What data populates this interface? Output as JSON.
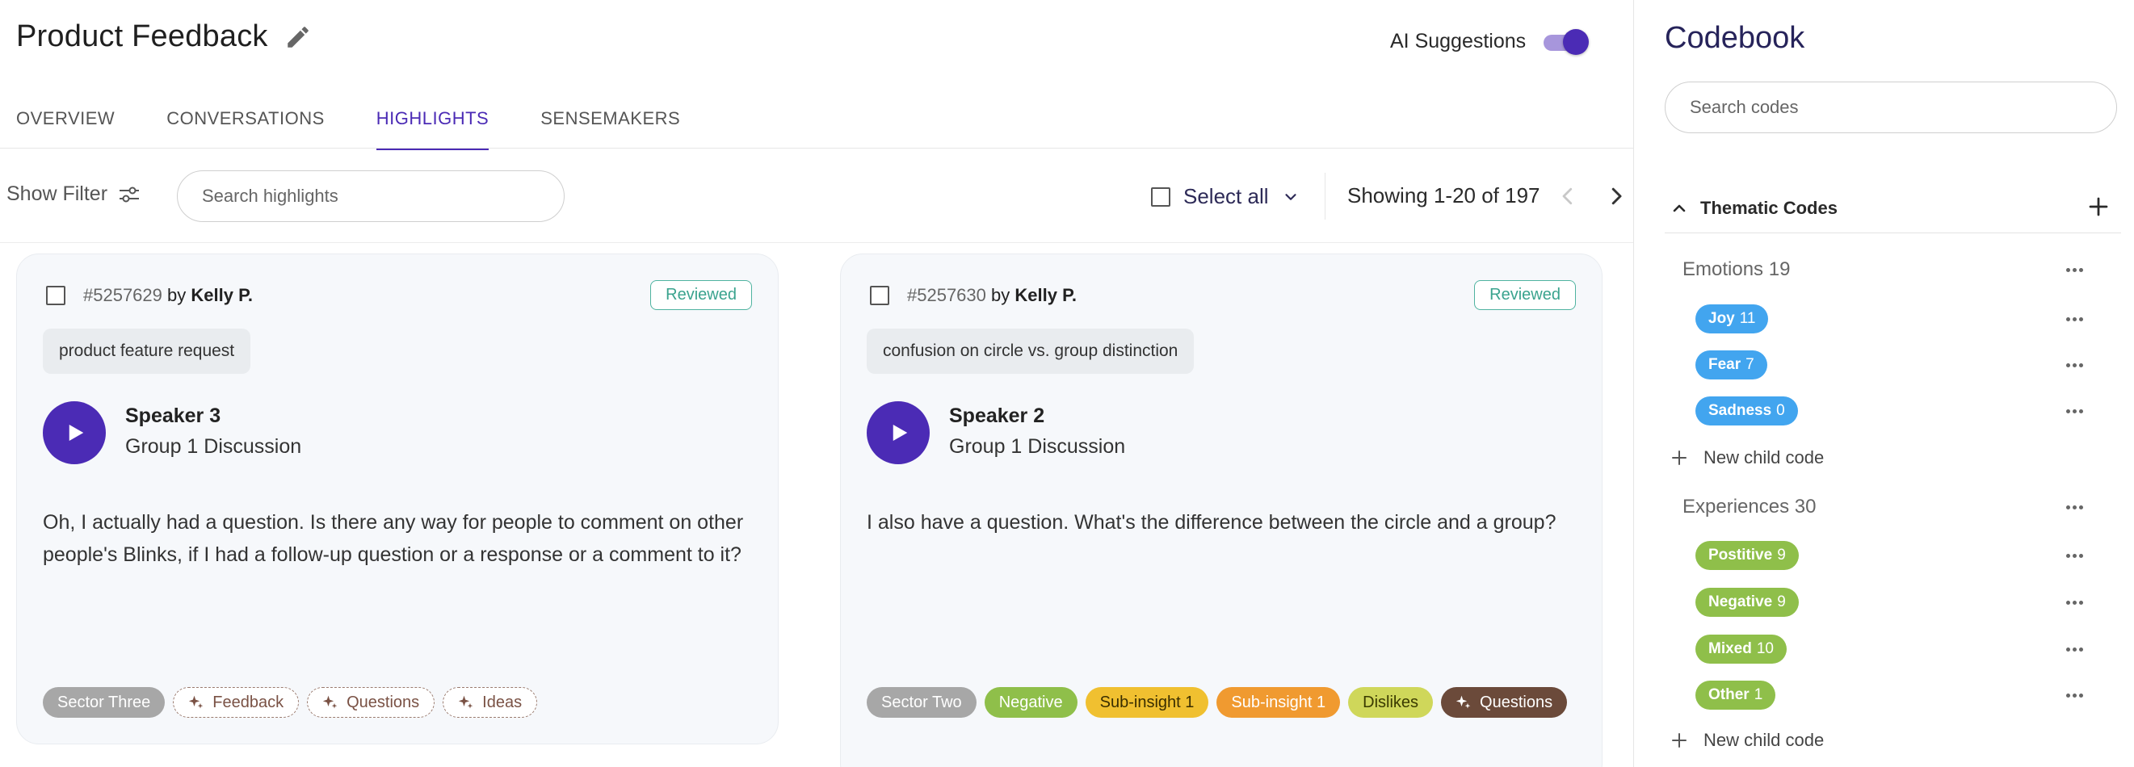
{
  "header": {
    "title": "Product Feedback",
    "ai_label": "AI Suggestions",
    "ai_enabled": true
  },
  "tabs": [
    {
      "label": "OVERVIEW",
      "active": false
    },
    {
      "label": "CONVERSATIONS",
      "active": false
    },
    {
      "label": "HIGHLIGHTS",
      "active": true
    },
    {
      "label": "SENSEMAKERS",
      "active": false
    }
  ],
  "toolbar": {
    "show_filter": "Show Filter",
    "search_placeholder": "Search highlights",
    "select_all": "Select all",
    "showing": "Showing 1-20 of 197"
  },
  "cards": [
    {
      "id": "#5257629",
      "by": "by",
      "author": "Kelly P.",
      "status": "Reviewed",
      "topic": "product feature request",
      "speaker": "Speaker 3",
      "group": "Group 1 Discussion",
      "text": "Oh, I actually had a question. Is there any way for people to comment on other people's Blinks, if I had a follow-up question or a response or a comment to it?",
      "tags": [
        {
          "label": "Sector Three",
          "style": "grey",
          "ai": false
        },
        {
          "label": "Feedback",
          "style": "ai",
          "ai": true
        },
        {
          "label": "Questions",
          "style": "ai",
          "ai": true
        },
        {
          "label": "Ideas",
          "style": "ai",
          "ai": true
        }
      ]
    },
    {
      "id": "#5257630",
      "by": "by",
      "author": "Kelly P.",
      "status": "Reviewed",
      "topic": "confusion on circle vs. group distinction",
      "speaker": "Speaker 2",
      "group": "Group 1 Discussion",
      "text": "I also have a question. What's the difference between the circle and a group?",
      "tags": [
        {
          "label": "Sector Two",
          "style": "grey",
          "ai": false
        },
        {
          "label": "Negative",
          "style": "green",
          "ai": false
        },
        {
          "label": "Sub-insight 1",
          "style": "yellow",
          "ai": false
        },
        {
          "label": "Sub-insight 1",
          "style": "orange",
          "ai": false
        },
        {
          "label": "Dislikes",
          "style": "lime",
          "ai": false
        },
        {
          "label": "Questions",
          "style": "brown",
          "ai": true
        }
      ]
    }
  ],
  "codebook": {
    "title": "Codebook",
    "search_placeholder": "Search codes",
    "section": "Thematic Codes",
    "groups": [
      {
        "name": "Emotions",
        "count": "19",
        "codes": [
          {
            "name": "Joy",
            "count": "11"
          },
          {
            "name": "Fear",
            "count": "7"
          },
          {
            "name": "Sadness",
            "count": "0"
          }
        ],
        "new_child": "New child code"
      },
      {
        "name": "Experiences",
        "count": "30",
        "codes": [
          {
            "name": "Postitive",
            "count": "9"
          },
          {
            "name": "Negative",
            "count": "9"
          },
          {
            "name": "Mixed",
            "count": "10"
          },
          {
            "name": "Other",
            "count": "1"
          }
        ],
        "new_child": "New child code"
      }
    ],
    "colors": {
      "emotions": "#42a5ef",
      "experiences": "#8fbf4a",
      "accent": "#4b2bb5"
    }
  }
}
